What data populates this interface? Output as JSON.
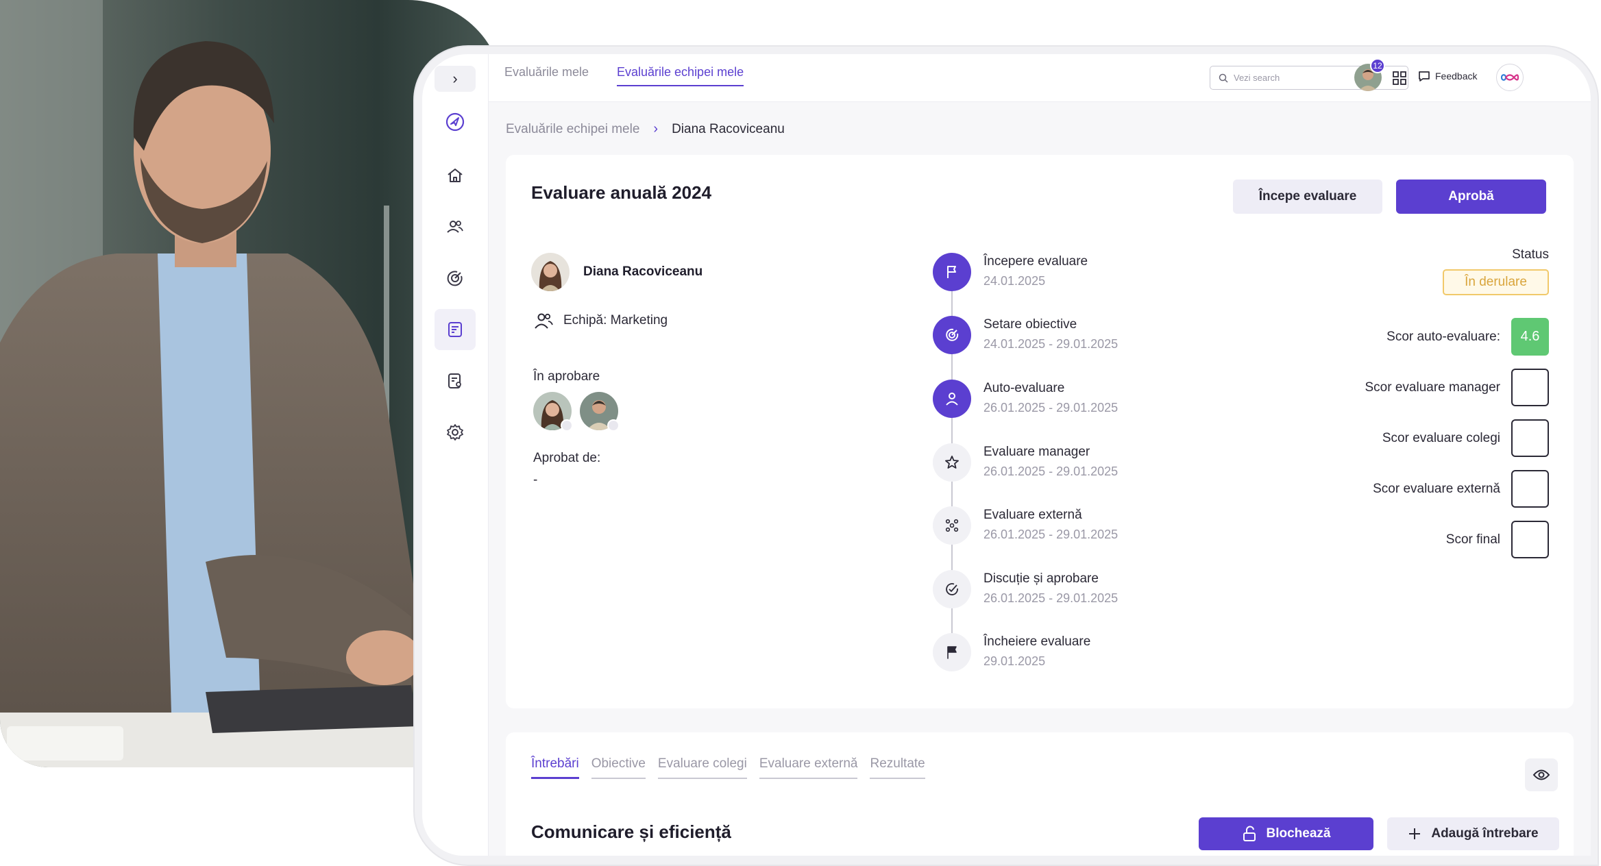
{
  "topbar": {
    "tabs": [
      "Evaluările mele",
      "Evaluările echipei mele"
    ],
    "active_tab": 1,
    "search_placeholder": "Vezi search",
    "notifications_count": "12",
    "feedback_label": "Feedback"
  },
  "breadcrumb": {
    "parent": "Evaluările echipei mele",
    "separator": "›",
    "current": "Diana Racoviceanu"
  },
  "evaluation": {
    "title": "Evaluare anuală 2024",
    "start_button": "Începe evaluare",
    "approve_button": "Aprobă",
    "employee_name": "Diana Racoviceanu",
    "team": "Echipă: Marketing",
    "approval_label": "În aprobare",
    "approved_by_label": "Aprobat de:",
    "approved_by_value": "-",
    "status_label": "Status",
    "status_value": "În derulare"
  },
  "timeline": [
    {
      "name": "Începere evaluare",
      "date": "24.01.2025",
      "state": "done",
      "icon": "flag-outline-icon"
    },
    {
      "name": "Setare obiective",
      "date": "24.01.2025 - 29.01.2025",
      "state": "done",
      "icon": "target-icon"
    },
    {
      "name": "Auto-evaluare",
      "date": "26.01.2025 - 29.01.2025",
      "state": "done",
      "icon": "user-icon"
    },
    {
      "name": "Evaluare manager",
      "date": "26.01.2025 - 29.01.2025",
      "state": "todo",
      "icon": "star-icon"
    },
    {
      "name": "Evaluare externă",
      "date": "26.01.2025 - 29.01.2025",
      "state": "todo",
      "icon": "network-icon"
    },
    {
      "name": "Discuție și aprobare",
      "date": "26.01.2025 - 29.01.2025",
      "state": "todo",
      "icon": "check-circle-icon"
    },
    {
      "name": "Încheiere evaluare",
      "date": "29.01.2025",
      "state": "todo",
      "icon": "flag-filled-icon"
    }
  ],
  "scores": [
    {
      "label": "Scor auto-evaluare:",
      "value": "4.6"
    },
    {
      "label": "Scor evaluare manager",
      "value": ""
    },
    {
      "label": "Scor evaluare colegi",
      "value": ""
    },
    {
      "label": "Scor evaluare externă",
      "value": ""
    },
    {
      "label": "Scor final",
      "value": ""
    }
  ],
  "lower": {
    "tabs": [
      "Întrebări",
      "Obiective",
      "Evaluare colegi",
      "Evaluare externă",
      "Rezultate"
    ],
    "active_tab": 0,
    "section_title": "Comunicare și eficiență",
    "lock_button": "Blochează",
    "add_button": "Adaugă întrebare"
  },
  "colors": {
    "accent": "#5b3fd0",
    "status_border": "#f1c96a",
    "score_filled": "#5fc873"
  }
}
